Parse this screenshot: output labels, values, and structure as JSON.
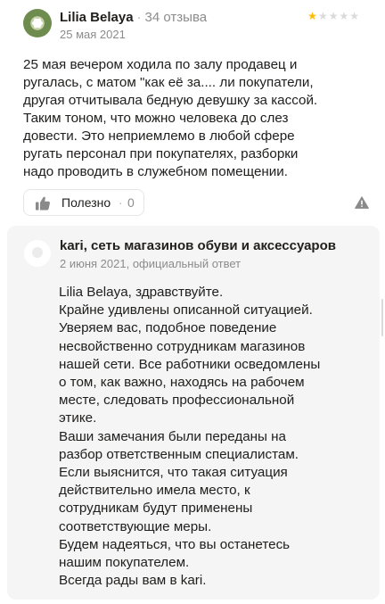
{
  "review": {
    "author_name": "Lilia Belaya",
    "separator": "·",
    "review_count": "34 отзыва",
    "date": "25 мая 2021",
    "rating": 1,
    "rating_max": 5,
    "star_color": "#ffbc00",
    "text_lines": [
      "25 мая вечером ходила по залу продавец и",
      "ругалась, с матом \"как её за.... ли покупатели,",
      "другая отчитывала бедную девушку за кассой.",
      "Таким тоном, что можно человека до слез",
      "довести. Это неприемлемо в любой сфере",
      "ругать персонал при покупателях, разборки",
      "надо проводить в служебном помещении."
    ],
    "useful_label": "Полезно",
    "useful_separator": "·",
    "useful_count": "0",
    "icons": {
      "avatar": "flower-avatar",
      "useful": "thumbs-up-icon",
      "report": "warning-icon"
    }
  },
  "reply": {
    "company_name": "kari, сеть магазинов обуви и аксессуаров",
    "meta": "2 июня 2021, официальный ответ",
    "text_lines": [
      "Lilia Belaya, здравствуйте.",
      "Крайне удивлены описанной ситуацией.",
      "Уверяем вас, подобное поведение",
      "несвойственно сотрудникам магазинов",
      "нашей сети. Все работники осведомлены",
      "о том, как важно, находясь на рабочем",
      "месте, следовать профессиональной",
      "этике.",
      "Ваши замечания были переданы на",
      "разбор ответственным специалистам.",
      "Если выяснится, что такая ситуация",
      "действительно имела место, к",
      "сотрудникам будут применены",
      "соответствующие меры.",
      "Будем надеяться, что вы останетесь",
      "нашим покупателем.",
      "Всегда рады вам в kari."
    ],
    "background": "#f5f5f5"
  }
}
